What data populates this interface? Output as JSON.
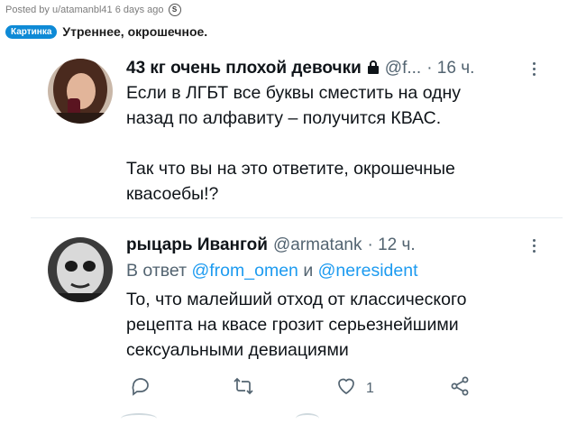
{
  "reddit": {
    "posted_by": "Posted by u/atamanbl41 6 days ago",
    "award_icon": "award-icon",
    "flair": "Картинка",
    "title": "Утреннее, окрошечное."
  },
  "tweets": [
    {
      "name": "43 кг очень плохой девочки",
      "lock_icon": "lock-icon",
      "handle": "@f...",
      "time": "· 16 ч.",
      "text": "Если в ЛГБТ все буквы сместить на одну\nназад по алфавиту – получится КВАС.\n\nТак что вы на это ответите, окрошечные\nквасоебы!?"
    },
    {
      "name": "рыцарь Ивангой",
      "handle": "@armatank",
      "time": "· 12 ч.",
      "reply_prefix": "В ответ",
      "reply_user1": "@from_omen",
      "reply_and": "и",
      "reply_user2": "@neresident",
      "text": "То, что малейший отход от классического\nрецепта на квасе грозит серьезнейшими\nсексуальными девиациями",
      "actions": {
        "reply_icon": "reply-icon",
        "retweet_icon": "retweet-icon",
        "like_icon": "like-icon",
        "like_count": "1",
        "share_icon": "share-icon"
      }
    }
  ]
}
